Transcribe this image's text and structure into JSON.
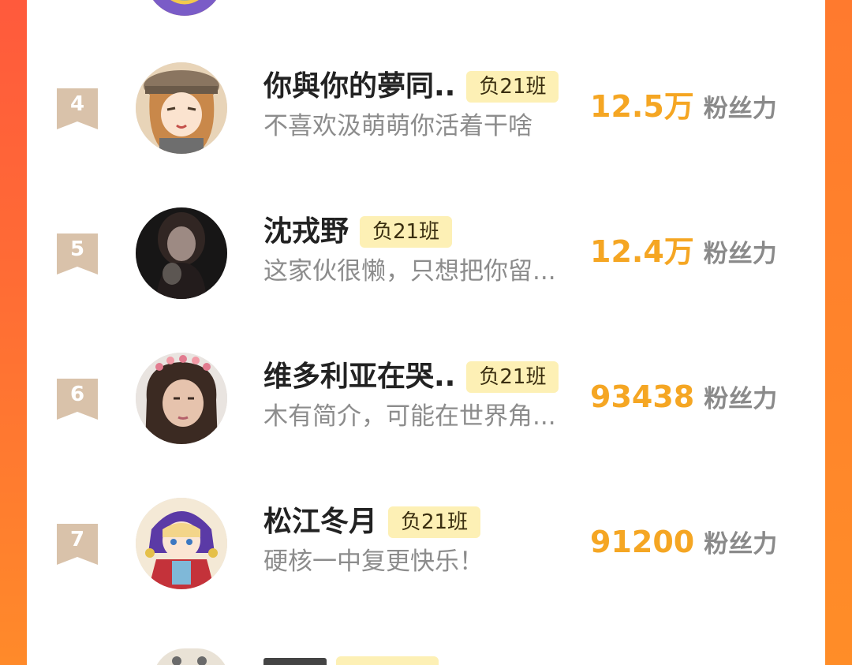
{
  "leaderboard": {
    "rows": [
      {
        "rank": "4",
        "name": "你與你的夢同..",
        "class_badge": "负21班",
        "bio": "不喜欢汲萌萌你活着干啥",
        "fans_value": "12.5万",
        "fans_label": "粉丝力",
        "avatar_icon": "anime-girl-cap-avatar"
      },
      {
        "rank": "5",
        "name": "沈戎野",
        "class_badge": "负21班",
        "bio": "这家伙很懒，只想把你留...",
        "fans_value": "12.4万",
        "fans_label": "粉丝力",
        "avatar_icon": "dark-photo-avatar"
      },
      {
        "rank": "6",
        "name": "维多利亚在哭..",
        "class_badge": "负21班",
        "bio": "木有简介，可能在世界角...",
        "fans_value": "93438",
        "fans_label": "粉丝力",
        "avatar_icon": "girl-flower-crown-avatar"
      },
      {
        "rank": "7",
        "name": "松江冬月",
        "class_badge": "负21班",
        "bio": "硬核一中复更快乐！",
        "fans_value": "91200",
        "fans_label": "粉丝力",
        "avatar_icon": "anime-red-hood-avatar"
      }
    ]
  },
  "colors": {
    "accent_orange": "#f5a623",
    "rank_ribbon": "#d9c2aa",
    "badge_bg": "#fdf0b5",
    "frame_red": "#ff5a3c",
    "frame_orange": "#ff8a2a"
  }
}
